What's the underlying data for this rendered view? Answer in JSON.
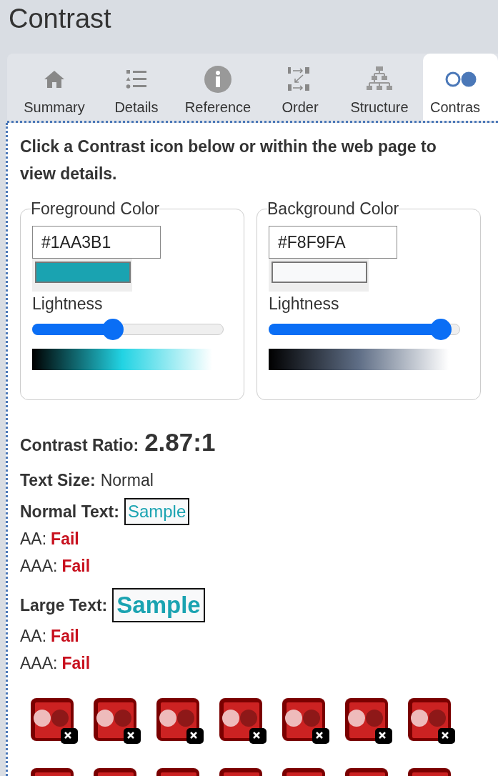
{
  "header": {
    "title": "Contrast"
  },
  "tabs": [
    {
      "label": "Summary",
      "selected": false
    },
    {
      "label": "Details",
      "selected": false
    },
    {
      "label": "Reference",
      "selected": false
    },
    {
      "label": "Order",
      "selected": false
    },
    {
      "label": "Structure",
      "selected": false
    },
    {
      "label": "Contras",
      "selected": true
    }
  ],
  "instructions": "Click a Contrast icon below or within the web page to view details.",
  "colors": [
    {
      "legend": "Foreground Color",
      "value": "#1AA3B1",
      "slider_label": "Lightness",
      "level": 0.42
    },
    {
      "legend": "Background Color",
      "value": "#F8F9FA",
      "slider_label": "Lightness",
      "level": 0.9
    }
  ],
  "ratio": {
    "label": "Contrast Ratio:",
    "value": "2.87:1"
  },
  "text_size": {
    "label": "Text Size:",
    "value": "Normal"
  },
  "results": [
    {
      "label": "Normal Text:",
      "sample": "Sample",
      "levels": [
        {
          "label": "AA:",
          "result": "Fail",
          "passed": false
        },
        {
          "label": "AAA:",
          "result": "Fail",
          "passed": false
        }
      ]
    },
    {
      "label": "Large Text:",
      "sample": "Sample",
      "levels": [
        {
          "label": "AA:",
          "result": "Fail",
          "passed": false
        },
        {
          "label": "AAA:",
          "result": "Fail",
          "passed": false
        }
      ]
    }
  ],
  "contrast_icons": [
    {
      "passed": false
    },
    {
      "passed": false
    },
    {
      "passed": false
    },
    {
      "passed": false
    },
    {
      "passed": false
    },
    {
      "passed": false
    },
    {
      "passed": false
    },
    {
      "passed": false
    },
    {
      "passed": false
    },
    {
      "passed": false
    },
    {
      "passed": false
    },
    {
      "passed": false
    },
    {
      "passed": false
    },
    {
      "passed": false
    }
  ]
}
